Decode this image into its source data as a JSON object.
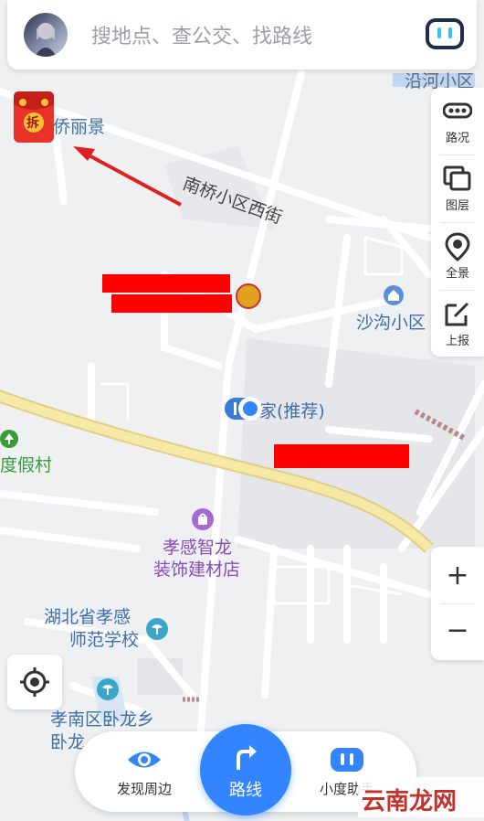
{
  "search": {
    "placeholder": "搜地点、查公交、找路线"
  },
  "right_panel": {
    "items": [
      {
        "label": "路况",
        "icon": "traffic-icon"
      },
      {
        "label": "图层",
        "icon": "layers-icon"
      },
      {
        "label": "全景",
        "icon": "panorama-icon"
      },
      {
        "label": "上报",
        "icon": "report-icon"
      }
    ]
  },
  "zoom": {
    "in_label": "+",
    "out_label": "−"
  },
  "bottom_bar": {
    "discover_label": "发现周边",
    "route_label": "路线",
    "assistant_label": "小度助手"
  },
  "map": {
    "labels": {
      "yanhe": "沿河小区",
      "qiaoli": "侨丽景",
      "nanqiao": "南桥小区西街",
      "shagou": "沙沟小区",
      "recommended": "家(推荐)",
      "dujia": "度假村",
      "zhilong_1": "孝感智龙",
      "zhilong_2": "装饰建材店",
      "shifan_1": "湖北省孝感",
      "shifan_2": "师范学校",
      "wolong_1": "孝南区卧龙乡",
      "wolong_2": "卧龙"
    },
    "red_packet_text": "拆"
  },
  "watermark": {
    "text": "云南龙网"
  },
  "colors": {
    "accent": "#3385ff",
    "road_major": "#f6e9a6",
    "park_label": "#3a9a3a",
    "poi_purple": "#8b4bb8",
    "redaction": "#ff0000"
  }
}
